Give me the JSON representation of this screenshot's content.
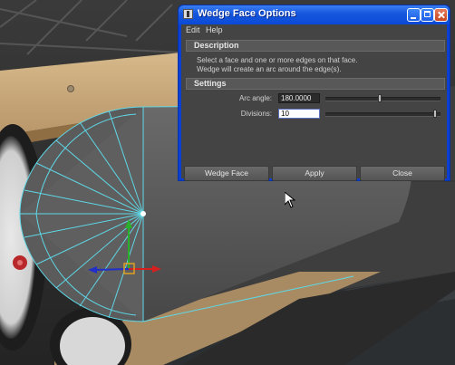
{
  "dialog": {
    "title": "Wedge Face Options",
    "menu": {
      "edit": "Edit",
      "help": "Help"
    },
    "description": {
      "heading": "Description",
      "line1": "Select a face and one or more edges on that face.",
      "line2": "Wedge will create an arc around the edge(s)."
    },
    "settings": {
      "heading": "Settings",
      "arc_angle_label": "Arc angle:",
      "arc_angle_value": "180.0000",
      "arc_angle_slider_fraction": 0.47,
      "divisions_label": "Divisions:",
      "divisions_value": "10",
      "divisions_slider_fraction": 0.97
    },
    "buttons": {
      "wedge_face": "Wedge Face",
      "apply": "Apply",
      "close": "Close"
    }
  },
  "colors": {
    "titlebar": "#1758df",
    "panel": "#444444",
    "wireframe": "#5fd7e6",
    "x_axis": "#d62020",
    "y_axis": "#2bb02b",
    "z_axis": "#2030c8",
    "manipulator": "#e0a020"
  }
}
